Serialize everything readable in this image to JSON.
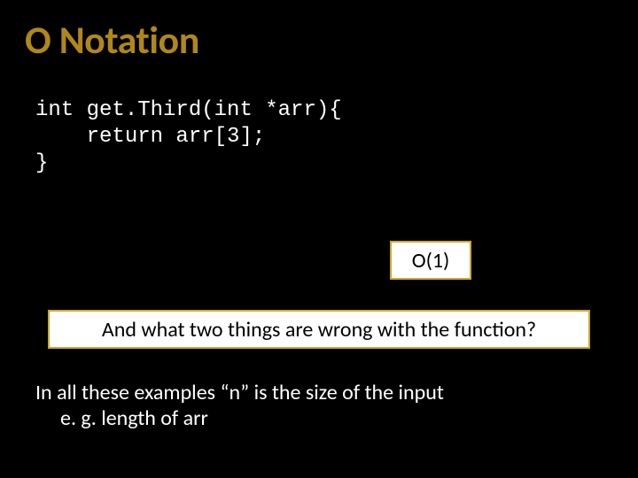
{
  "title": "O Notation",
  "code": {
    "line1": "int get.Third(int *arr){",
    "line2": "    return arr[3];",
    "line3": "}"
  },
  "callout_o1": "O(1)",
  "callout_question": "And what two things are wrong with the function?",
  "footnote": {
    "line1": "In all these examples “n” is the size of the input",
    "line2": "e. g. length of arr"
  }
}
